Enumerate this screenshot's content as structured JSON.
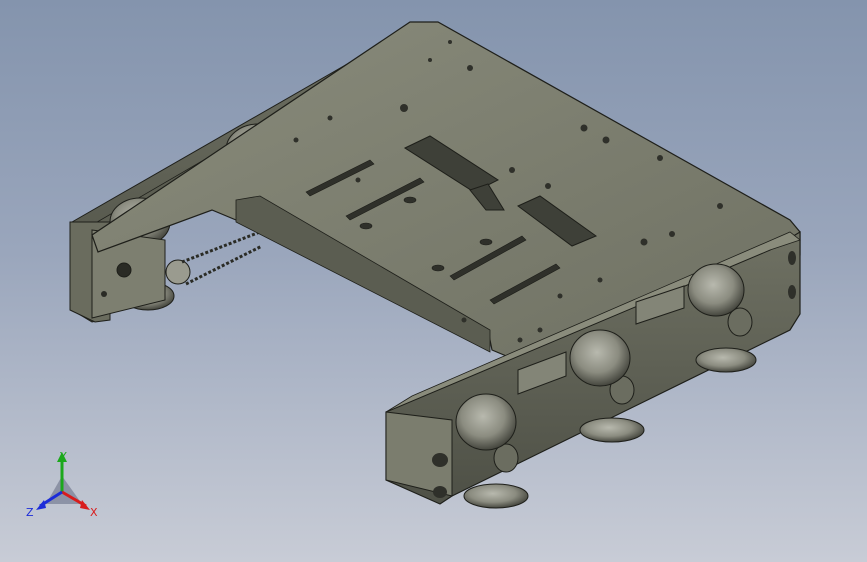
{
  "viewport": {
    "background_top": "#8494ad",
    "background_bottom": "#c8ccd6",
    "model_color": "#7b7d6e",
    "model_edge_color": "#1e1f1a"
  },
  "triad": {
    "x_label": "X",
    "y_label": "Y",
    "z_label": "Z",
    "x_color": "#d81c1c",
    "y_color": "#1ca81c",
    "z_color": "#1c2cd8"
  }
}
